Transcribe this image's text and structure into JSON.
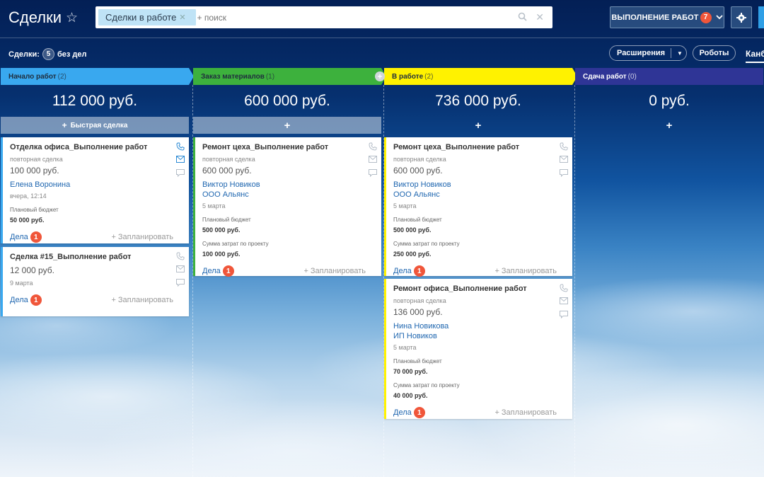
{
  "header": {
    "title": "Сделки",
    "filter_chip": "Сделки в работе",
    "search_placeholder": "+ поиск",
    "mode_label": "ВЫПОЛНЕНИЕ РАБОТ",
    "mode_badge": "7"
  },
  "subheader": {
    "deals_label": "Сделки:",
    "deals_count": "5",
    "deals_suffix": "без дел",
    "extensions": "Расширения",
    "robots": "Роботы",
    "kanban": "Канбан"
  },
  "columns": [
    {
      "stage": "Начало работ",
      "count": "(2)",
      "color": "#39a8ef",
      "text_color": "#1f2d3d",
      "sum": "112 000 руб.",
      "quick": "Быстрая сделка",
      "cards": [
        {
          "title": "Отделка офиса_Выполнение работ",
          "kind": "повторная сделка",
          "price": "100 000 руб.",
          "contact": "Елена Воронина",
          "date": "вчера, 12:14",
          "budget_label": "Плановый бюджет",
          "budget": "50 000 руб.",
          "tasks": "Дела",
          "tasks_count": "1",
          "plan": "+ Запланировать"
        },
        {
          "title": "Сделка #15_Выполнение работ",
          "price": "12 000 руб.",
          "date": "9 марта",
          "tasks": "Дела",
          "tasks_count": "1",
          "plan": "+ Запланировать"
        }
      ]
    },
    {
      "stage": "Заказ материалов",
      "count": "(1)",
      "color": "#3db13d",
      "text_color": "#1f2d3d",
      "sum": "600 000 руб.",
      "quick": "+",
      "cards": [
        {
          "title": "Ремонт цеха_Выполнение работ",
          "kind": "повторная сделка",
          "price": "600 000 руб.",
          "contact": "Виктор Новиков",
          "company": "ООО Альянс",
          "date": "5 марта",
          "budget_label": "Плановый бюджет",
          "budget": "500 000 руб.",
          "cost_label": "Сумма затрат по проекту",
          "cost": "100 000 руб.",
          "tasks": "Дела",
          "tasks_count": "1",
          "plan": "+ Запланировать"
        }
      ]
    },
    {
      "stage": "В работе",
      "count": "(2)",
      "color": "#fff200",
      "text_color": "#1f2d3d",
      "sum": "736 000 руб.",
      "quick": "+",
      "cards": [
        {
          "title": "Ремонт цеха_Выполнение работ",
          "kind": "повторная сделка",
          "price": "600 000 руб.",
          "contact": "Виктор Новиков",
          "company": "ООО Альянс",
          "date": "5 марта",
          "budget_label": "Плановый бюджет",
          "budget": "500 000 руб.",
          "cost_label": "Сумма затрат по проекту",
          "cost": "250 000 руб.",
          "tasks": "Дела",
          "tasks_count": "1",
          "plan": "+ Запланировать"
        },
        {
          "title": "Ремонт офиса_Выполнение работ",
          "kind": "повторная сделка",
          "price": "136 000 руб.",
          "contact": "Нина Новикова",
          "company": "ИП Новиков",
          "date": "5 марта",
          "budget_label": "Плановый бюджет",
          "budget": "70 000 руб.",
          "cost_label": "Сумма затрат по проекту",
          "cost": "40 000 руб.",
          "tasks": "Дела",
          "tasks_count": "1",
          "plan": "+ Запланировать"
        }
      ]
    },
    {
      "stage": "Сдача работ",
      "count": "(0)",
      "color": "#2f3596",
      "text_color": "#ffffff",
      "sum": "0 руб.",
      "quick": "+",
      "cards": []
    }
  ],
  "icons": {
    "star": "star-icon",
    "phone": "phone-icon",
    "mail": "mail-icon",
    "chat": "chat-icon",
    "gear": "gear-icon",
    "search": "search-icon",
    "clear": "close-icon",
    "chevron": "chevron-down-icon"
  }
}
